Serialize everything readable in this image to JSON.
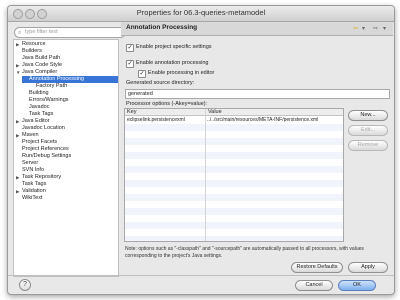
{
  "window": {
    "title": "Properties for 06.3-queries-metamodel"
  },
  "filter": {
    "placeholder": "type filter text",
    "icon": "search-icon"
  },
  "tree": {
    "items": [
      {
        "label": "Resource",
        "expandable": true
      },
      {
        "label": "Builders"
      },
      {
        "label": "Java Build Path"
      },
      {
        "label": "Java Code Style",
        "expandable": true
      },
      {
        "label": "Java Compiler",
        "expanded": true
      },
      {
        "label": "Annotation Processing",
        "selected": true
      },
      {
        "label": "Factory Path"
      },
      {
        "label": "Building"
      },
      {
        "label": "Errors/Warnings"
      },
      {
        "label": "Javadoc"
      },
      {
        "label": "Task Tags"
      },
      {
        "label": "Java Editor",
        "expandable": true
      },
      {
        "label": "Javadoc Location"
      },
      {
        "label": "Maven",
        "expandable": true
      },
      {
        "label": "Project Facets"
      },
      {
        "label": "Project References"
      },
      {
        "label": "Run/Debug Settings"
      },
      {
        "label": "Server"
      },
      {
        "label": "SVN Info"
      },
      {
        "label": "Task Repository",
        "expandable": true
      },
      {
        "label": "Task Tags"
      },
      {
        "label": "Validation",
        "expandable": true
      },
      {
        "label": "WikiText"
      }
    ]
  },
  "header": {
    "title": "Annotation Processing",
    "back_icon": "back-arrow-icon",
    "forward_icon": "forward-arrow-icon"
  },
  "settings": {
    "project_specific": {
      "label": "Enable project specific settings",
      "checked": true
    },
    "enable_processing": {
      "label": "Enable annotation processing",
      "checked": true
    },
    "enable_in_editor": {
      "label": "Enable processing in editor",
      "checked": true
    },
    "generated_dir_label": "Generated source directory:",
    "generated_dir_value": "generated",
    "processor_options_label": "Processor options (-Akey=value):"
  },
  "table": {
    "columns": [
      "Key",
      "Value"
    ],
    "rows": [
      {
        "key": "eclipselink.persistencexml",
        "value": "../../src/main/resources/META-INF/persistence.xml"
      }
    ]
  },
  "buttons": {
    "new": "New...",
    "edit": "Edit...",
    "remove": "Remove",
    "restore_defaults": "Restore Defaults",
    "apply": "Apply",
    "cancel": "Cancel",
    "ok": "OK",
    "help": "?"
  },
  "note": "Note: options such as \"-classpath\" and \"-sourcepath\" are automatically passed to all processors, with values corresponding to the project's Java settings."
}
